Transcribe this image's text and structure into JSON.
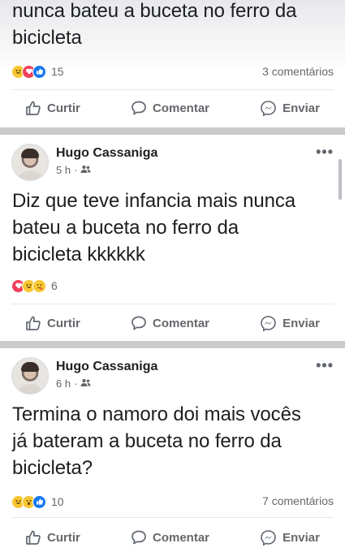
{
  "posts": [
    {
      "text": "nunca bateu a buceta no ferro da\nbicicleta",
      "reactions": [
        "laugh",
        "love",
        "like"
      ],
      "reaction_count": "15",
      "comments": "3 comentários"
    },
    {
      "author": "Hugo Cassaniga",
      "time": "5 h",
      "audience_icon": "friends-icon",
      "text": "Diz que teve infancia mais nunca\nbateu a buceta no ferro da\nbicicleta kkkkkk",
      "reactions": [
        "love",
        "laugh",
        "wow"
      ],
      "reaction_count": "6",
      "comments": ""
    },
    {
      "author": "Hugo Cassaniga",
      "time": "6 h",
      "audience_icon": "friends-icon",
      "text": "Termina o namoro doi mais vocês\njá bateram a buceta no ferro da\nbicicleta?",
      "reactions": [
        "laugh",
        "wow",
        "like"
      ],
      "reaction_count": "10",
      "comments": "7 comentários"
    }
  ],
  "actions": {
    "like": "Curtir",
    "comment": "Comentar",
    "send": "Enviar"
  },
  "more_glyph": "•••",
  "colors": {
    "background": "#c9cacc",
    "card": "#ffffff",
    "secondary_text": "#65676b",
    "like_blue": "#1877f2",
    "love_red": "#f33e58",
    "emoji_yellow": "#f7c631"
  }
}
